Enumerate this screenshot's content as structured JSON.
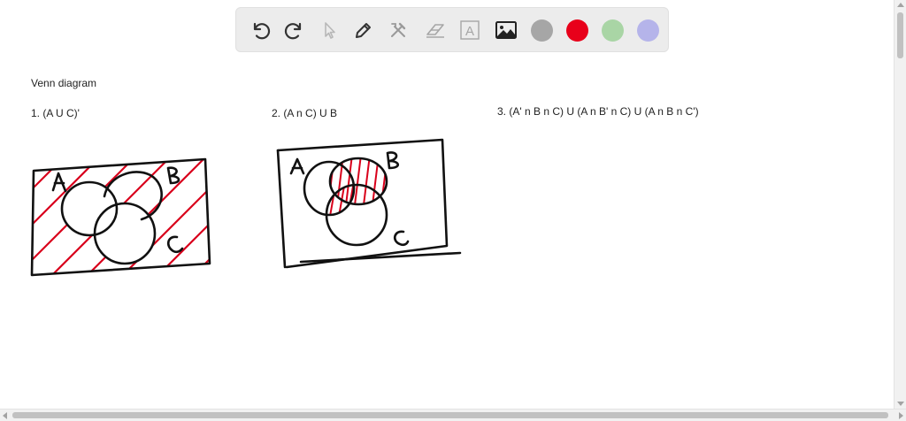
{
  "toolbar": {
    "tools": [
      {
        "name": "undo-icon"
      },
      {
        "name": "redo-icon"
      },
      {
        "name": "pointer-icon"
      },
      {
        "name": "pen-icon"
      },
      {
        "name": "tools-icon"
      },
      {
        "name": "eraser-icon"
      },
      {
        "name": "text-icon",
        "glyph": "A"
      },
      {
        "name": "image-icon"
      }
    ],
    "colors": [
      "#a6a6a6",
      "#e8001a",
      "#a9d5a5",
      "#b5b4ea"
    ]
  },
  "content": {
    "heading": "Venn diagram",
    "problem1": "1. (A U C)'",
    "problem2": "2. (A n C) U B",
    "problem3": "3. (A' n B n C) U (A n B' n C) U (A n B n C')"
  },
  "diagram1": {
    "label_a": "A",
    "label_b": "B",
    "label_c": "C"
  },
  "diagram2": {
    "label_a": "A",
    "label_b": "B",
    "label_c": "C"
  },
  "style": {
    "ink": "#111111",
    "highlight": "#d9001b"
  }
}
